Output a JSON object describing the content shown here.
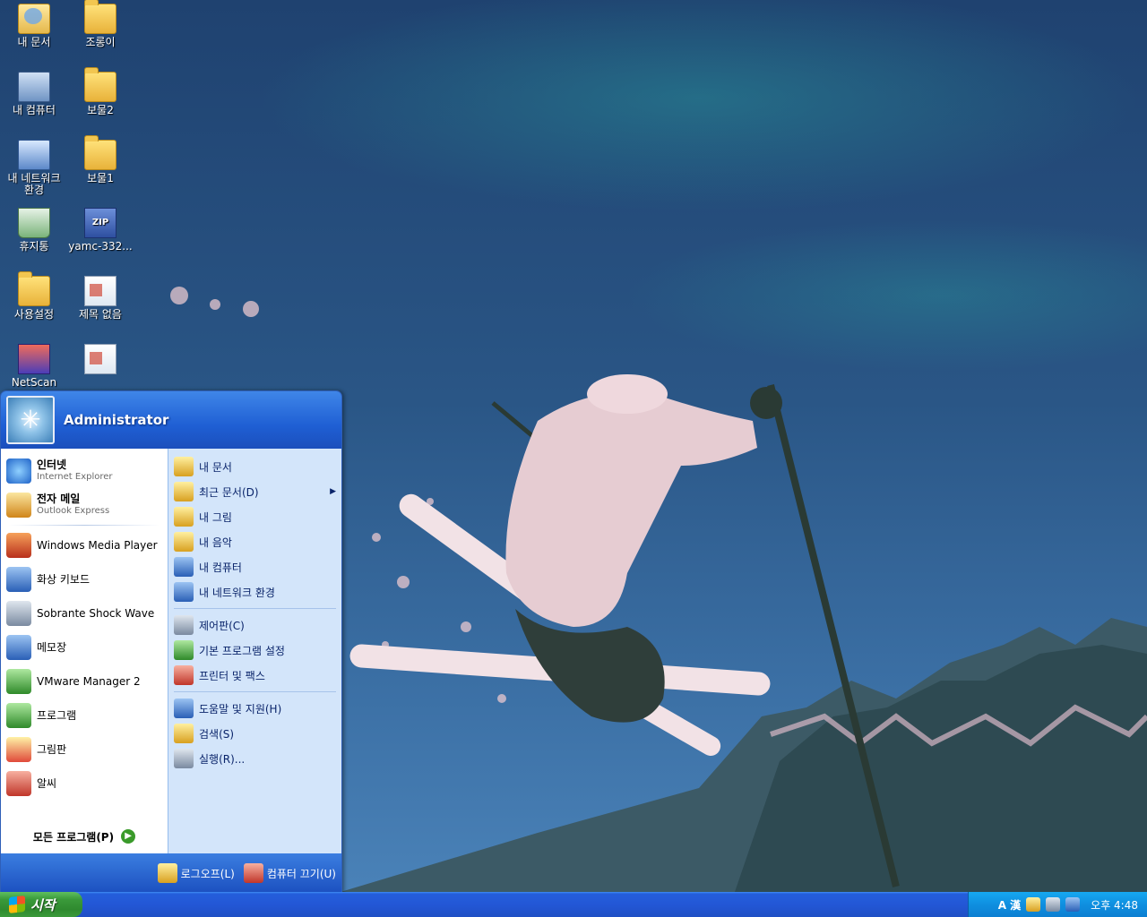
{
  "desktop": {
    "icons": [
      {
        "label": "내 문서"
      },
      {
        "label": "조롱이"
      },
      {
        "label": "내 컴퓨터"
      },
      {
        "label": "보물2"
      },
      {
        "label": "내 네트워크 환경"
      },
      {
        "label": "보물1"
      },
      {
        "label": "휴지통"
      },
      {
        "label": "yamc-332..."
      },
      {
        "label": "사용설정"
      },
      {
        "label": "제목 없음"
      },
      {
        "label": "NetScan"
      }
    ]
  },
  "start_menu": {
    "user": "Administrator",
    "pinned": [
      {
        "title": "인터넷",
        "subtitle": "Internet Explorer"
      },
      {
        "title": "전자 메일",
        "subtitle": "Outlook Express"
      }
    ],
    "recent": [
      {
        "title": "Windows Media Player"
      },
      {
        "title": "화상 키보드"
      },
      {
        "title": "Sobrante Shock Wave"
      },
      {
        "title": "메모장"
      },
      {
        "title": "VMware Manager 2"
      },
      {
        "title": "프로그램"
      },
      {
        "title": "그림판"
      },
      {
        "title": "알씨"
      }
    ],
    "all_programs": "모든 프로그램(P)",
    "right_items": [
      {
        "label": "내 문서",
        "arrow": ""
      },
      {
        "label": "최근 문서(D)",
        "arrow": "▶"
      },
      {
        "label": "내 그림",
        "arrow": ""
      },
      {
        "label": "내 음악",
        "arrow": ""
      },
      {
        "label": "내 컴퓨터",
        "arrow": ""
      },
      {
        "label": "내 네트워크 환경",
        "arrow": ""
      },
      {
        "label": "제어판(C)",
        "arrow": ""
      },
      {
        "label": "기본 프로그램 설정",
        "arrow": ""
      },
      {
        "label": "프린터 및 팩스",
        "arrow": ""
      },
      {
        "label": "도움말 및 지원(H)",
        "arrow": ""
      },
      {
        "label": "검색(S)",
        "arrow": ""
      },
      {
        "label": "실행(R)...",
        "arrow": ""
      }
    ],
    "footer": {
      "logoff": "로그오프(L)",
      "shutdown": "컴퓨터 끄기(U)"
    }
  },
  "taskbar": {
    "start_label": "시작",
    "ime": "A 漢",
    "clock": "오후 4:48"
  }
}
